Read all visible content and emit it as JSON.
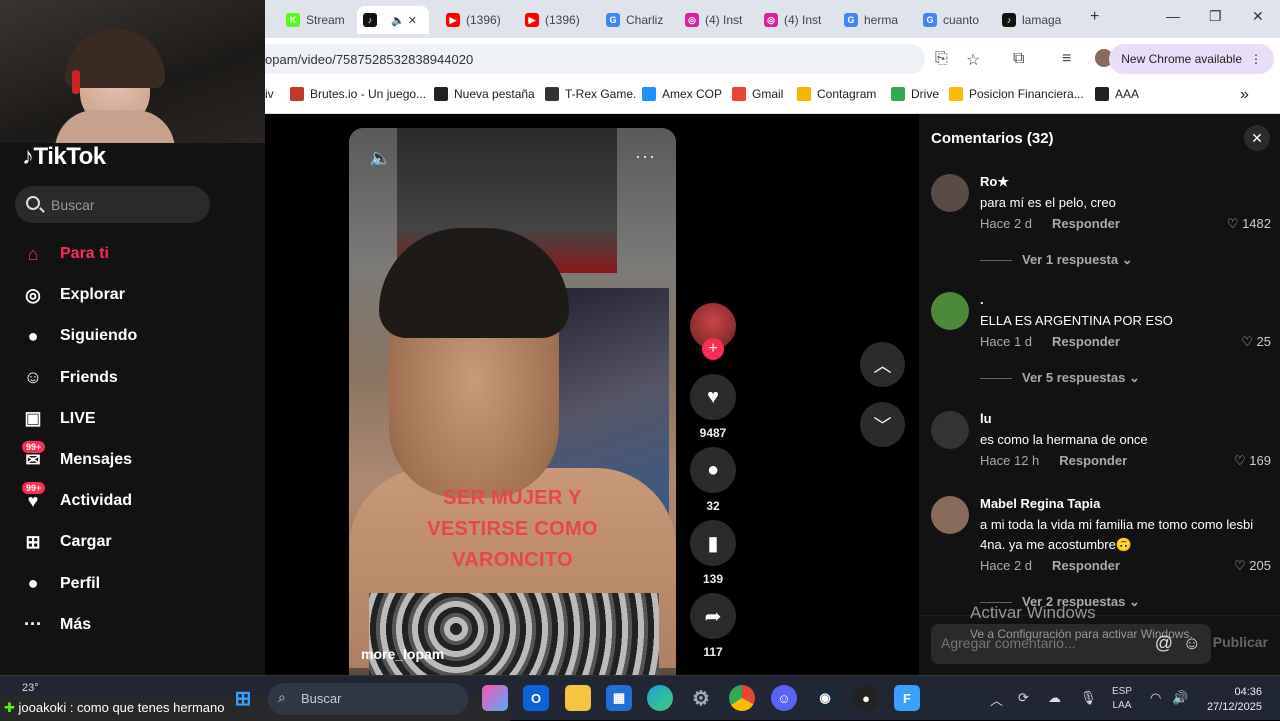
{
  "tabs": [
    {
      "label": "Stream",
      "color": "#53fc18",
      "glyph": "K"
    },
    {
      "label": "",
      "color": "#111",
      "glyph": "♪",
      "active": true
    },
    {
      "label": "(1396)",
      "color": "#f00",
      "glyph": "▶"
    },
    {
      "label": "(1396)",
      "color": "#f00",
      "glyph": "▶"
    },
    {
      "label": "Charliz",
      "color": "#4285f4",
      "glyph": "G"
    },
    {
      "label": "(4) Inst",
      "color": "#d6249f",
      "glyph": "◎"
    },
    {
      "label": "(4) Inst",
      "color": "#d6249f",
      "glyph": "◎"
    },
    {
      "label": "herma",
      "color": "#4285f4",
      "glyph": "G"
    },
    {
      "label": "cuanto",
      "color": "#4285f4",
      "glyph": "G"
    },
    {
      "label": "lamaga",
      "color": "#111",
      "glyph": "♪"
    }
  ],
  "browser": {
    "url": "opam/video/7587528532838944020",
    "new_chrome": "New Chrome available"
  },
  "bookmarks": [
    {
      "label": "iv",
      "color": "transparent"
    },
    {
      "label": "Brutes.io - Un juego...",
      "color": "#c0392b"
    },
    {
      "label": "Nueva pestaña",
      "color": "#222"
    },
    {
      "label": "T-Rex Game.",
      "color": "#333"
    },
    {
      "label": "Amex COP",
      "color": "#1e90ff"
    },
    {
      "label": "Gmail",
      "color": "#ea4335"
    },
    {
      "label": "Contagram",
      "color": "#f5b400"
    },
    {
      "label": "Drive",
      "color": "#34a853"
    },
    {
      "label": "Posicion Financiera...",
      "color": "#fbbc04"
    },
    {
      "label": "AAA",
      "color": "#222"
    }
  ],
  "sidebar": {
    "logo": "TikTok",
    "search_placeholder": "Buscar",
    "items": [
      {
        "label": "Para ti",
        "icon": "home-icon",
        "glyph": "⌂",
        "active": true
      },
      {
        "label": "Explorar",
        "icon": "compass-icon",
        "glyph": "◎"
      },
      {
        "label": "Siguiendo",
        "icon": "following-icon",
        "glyph": "●"
      },
      {
        "label": "Friends",
        "icon": "friends-icon",
        "glyph": "☺"
      },
      {
        "label": "LIVE",
        "icon": "live-icon",
        "glyph": "▣"
      },
      {
        "label": "Mensajes",
        "icon": "messages-icon",
        "glyph": "✉",
        "badge": "99+"
      },
      {
        "label": "Actividad",
        "icon": "activity-icon",
        "glyph": "♥",
        "badge": "99+"
      },
      {
        "label": "Cargar",
        "icon": "upload-icon",
        "glyph": "⊞"
      },
      {
        "label": "Perfil",
        "icon": "profile-icon",
        "glyph": "●"
      },
      {
        "label": "Más",
        "icon": "more-icon",
        "glyph": "···"
      }
    ]
  },
  "video": {
    "overlay_lines": [
      "SER MUJER Y",
      "VESTIRSE COMO",
      "VARONCITO"
    ],
    "author": "more_lopam"
  },
  "actions": {
    "likes": "9487",
    "comments": "32",
    "saves": "139",
    "shares": "117"
  },
  "comments_panel": {
    "title": "Comentarios (32)",
    "items": [
      {
        "name": "Ro★",
        "text": "para mí es el pelo, creo",
        "time": "Hace 2 d",
        "reply": "Responder",
        "likes": "1482",
        "more": "Ver 1 respuesta",
        "avatar": "#5a4a48"
      },
      {
        "name": ".",
        "text": "ELLA ES ARGENTINA POR ESO",
        "time": "Hace 1 d",
        "reply": "Responder",
        "likes": "25",
        "more": "Ver 5 respuestas",
        "avatar": "#4a8a3a"
      },
      {
        "name": "lu",
        "text": "es como la hermana de once",
        "time": "Hace 12 h",
        "reply": "Responder",
        "likes": "169",
        "more": "",
        "avatar": "#333"
      },
      {
        "name": "Mabel Regina Tapia",
        "text": "a mi toda la vida mi familia me tomo como lesbi 4na. ya me acostumbre🙃",
        "time": "Hace 2 d",
        "reply": "Responder",
        "likes": "205",
        "more": "Ver 2 respuestas",
        "avatar": "#8a6a5a"
      }
    ],
    "input_placeholder": "Agregar comentario...",
    "post_label": "Publicar"
  },
  "watermark": {
    "line1": "Activar Windows",
    "line2": "Ve a Configuración para activar Windows."
  },
  "taskbar": {
    "weather": "23°",
    "chat": "jooakoki : como que tenes hermano",
    "search_placeholder": "Buscar",
    "lang1": "ESP",
    "lang2": "LAA",
    "time": "04:36",
    "date": "27/12/2025"
  }
}
